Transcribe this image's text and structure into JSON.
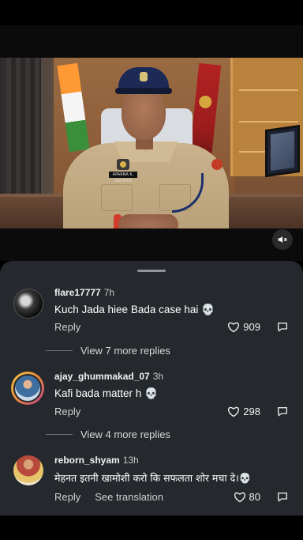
{
  "video": {
    "nameplate": "APARNA K. GAUSHIK",
    "mute_icon": "speaker-muted-icon"
  },
  "comments": [
    {
      "username": "flare17777",
      "time": "7h",
      "text": "Kuch Jada hiee Bada case hai 💀",
      "reply_label": "Reply",
      "likes": "909",
      "view_more": "View 7 more replies"
    },
    {
      "username": "ajay_ghummakad_07",
      "time": "3h",
      "text": "Kafi bada matter h 💀",
      "reply_label": "Reply",
      "likes": "298",
      "view_more": "View 4 more replies"
    },
    {
      "username": "reborn_shyam",
      "time": "13h",
      "text": "मेहनत इतनी खामोशी करो कि सफलता शोर मचा दे।💀",
      "reply_label": "Reply",
      "translation_label": "See translation",
      "likes": "80"
    }
  ],
  "colors": {
    "sheet_bg": "#25292d",
    "background": "#000000"
  }
}
